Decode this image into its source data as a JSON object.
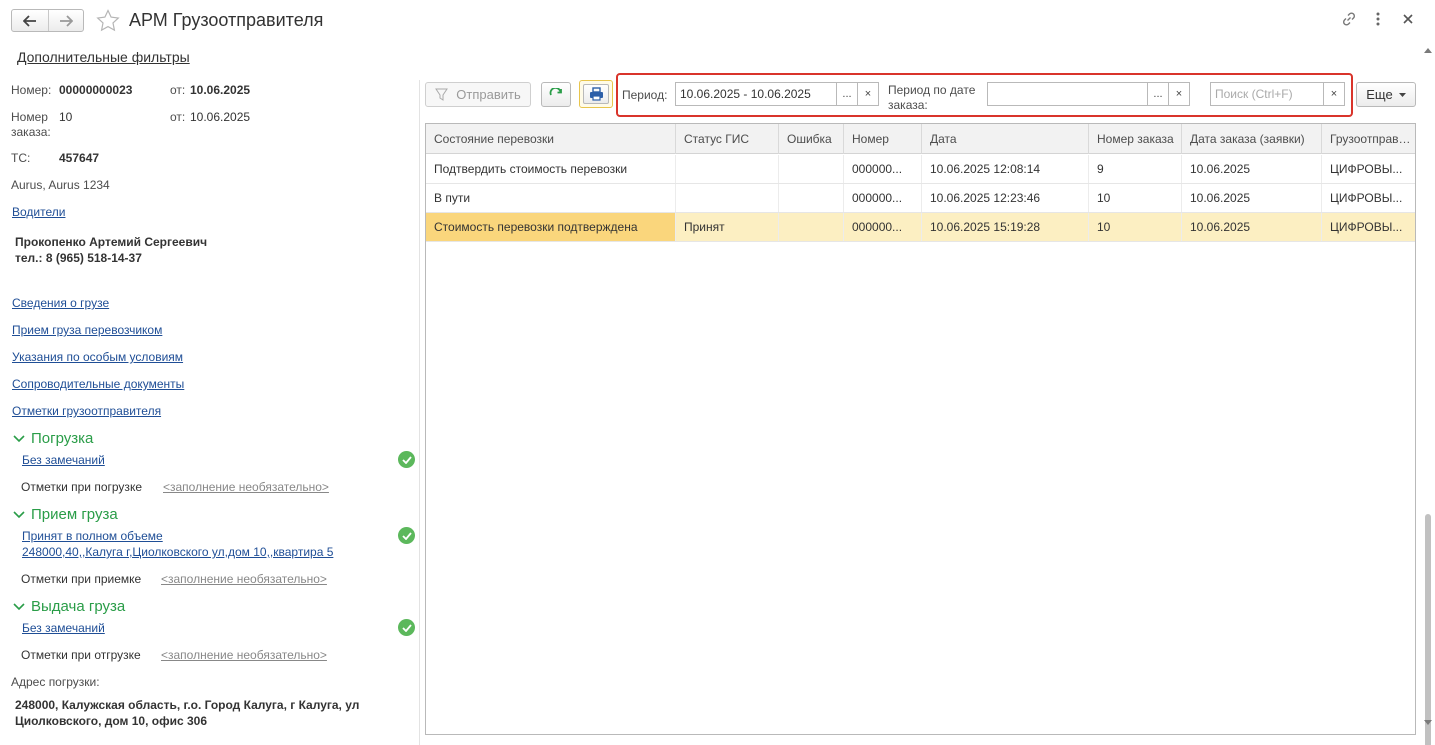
{
  "window": {
    "title": "АРМ Грузоотправителя",
    "nav": {
      "back_icon": "arrow-left-icon",
      "forward_icon": "arrow-right-icon"
    },
    "favorite_icon": "star-icon",
    "actions": [
      "link-icon",
      "more-vertical-icon",
      "close-icon"
    ]
  },
  "left": {
    "additional_filters": "Дополнительные фильтры",
    "number_label": "Номер:",
    "number_value": "00000000023",
    "number_from_label": "от:",
    "number_from_value": "10.06.2025",
    "order_label_1": "Номер",
    "order_label_2": "заказа:",
    "order_value": "10",
    "order_from_label": "от:",
    "order_from_value": "10.06.2025",
    "vehicle_label": "ТС:",
    "vehicle_value": "457647",
    "vehicle_model": "Aurus, Aurus 1234",
    "drivers_link": "Водители",
    "driver_name": "Прокопенко Артемий Сергеевич",
    "driver_phone": "тел.: 8 (965) 518-14-37",
    "links": [
      "Сведения о грузе",
      "Прием груза перевозчиком",
      "Указания по особым условиям",
      "Сопроводительные документы",
      "Отметки грузоотправителя"
    ],
    "loading": {
      "title": "Погрузка",
      "status": "Без замечаний",
      "marks_label": "Отметки при погрузке",
      "marks_hint": "<заполнение необязательно>"
    },
    "receiving": {
      "title": "Прием груза",
      "status_1": "Принят в полном объеме",
      "status_2": "248000,40,,Калуга г,Циолковского ул,дом 10,,квартира 5",
      "marks_label": "Отметки при приемке",
      "marks_hint": "<заполнение необязательно>"
    },
    "delivery": {
      "title": "Выдача груза",
      "status": "Без замечаний",
      "marks_label": "Отметки при отгрузке",
      "marks_hint": "<заполнение необязательно>"
    },
    "address_label": "Адрес погрузки:",
    "address_line1": "248000, Калужская область, г.о. Город Калуга, г Калуга, ул",
    "address_line2": "Циолковского, дом 10, офис 306"
  },
  "toolbar": {
    "send_label": "Отправить",
    "refresh_icon": "refresh-icon",
    "print_icon": "print-icon",
    "period_label": "Период:",
    "period_value": "10.06.2025 - 10.06.2025",
    "order_period_label_1": "Период по дате",
    "order_period_label_2": "заказа:",
    "order_period_value": "",
    "dots": "...",
    "clear": "×",
    "search_placeholder": "Поиск (Ctrl+F)",
    "more_label": "Еще",
    "accent_color": "#d9342b"
  },
  "table": {
    "columns": [
      "Состояние перевозки",
      "Статус ГИС",
      "Ошибка",
      "Номер",
      "Дата",
      "Номер заказа",
      "Дата заказа (заявки)",
      "Грузоотправитель"
    ],
    "rows": [
      [
        "Подтвердить стоимость перевозки",
        "",
        "",
        "000000...",
        "10.06.2025 12:08:14",
        "9",
        "10.06.2025",
        "ЦИФРОВЫ..."
      ],
      [
        "В пути",
        "",
        "",
        "000000...",
        "10.06.2025 12:23:46",
        "10",
        "10.06.2025",
        "ЦИФРОВЫ..."
      ],
      [
        "Стоимость перевозки подтверждена",
        "Принят",
        "",
        "000000...",
        "10.06.2025 15:19:28",
        "10",
        "10.06.2025",
        "ЦИФРОВЫ..."
      ]
    ],
    "selected_row": 2
  }
}
